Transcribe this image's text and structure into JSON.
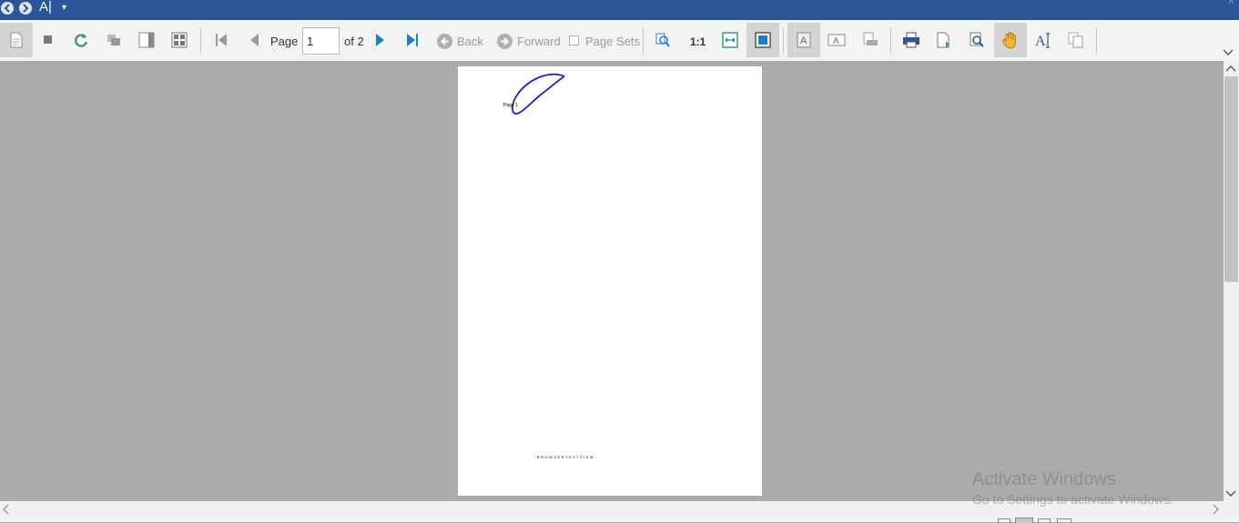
{
  "titlebar": {
    "title": "A|",
    "dropdown_glyph": "▾",
    "minimize_glyph": "^"
  },
  "toolbar": {
    "page_label": "Page",
    "page_value": "1",
    "page_of": "of 2",
    "back_label": "Back",
    "forward_label": "Forward",
    "page_sets_label": "Page Sets",
    "zoom_one_to_one": "1:1",
    "text_tool_glyph": "A",
    "accent_color": "#2b579a",
    "icon_blue": "#1c7fd1",
    "hand_color": "#f5a623"
  },
  "document": {
    "page_label": "Page 1",
    "footer_text": "- B R O W S E R  T E X T  V I E W -",
    "curve_color": "#1d1dcc"
  },
  "watermark": {
    "line1": "Activate Windows",
    "line2": "Go to Settings to activate Windows."
  },
  "icons": [
    "back-icon",
    "forward-icon",
    "document-icon",
    "stop-icon",
    "refresh-icon",
    "duplicate-icon",
    "sidebar-icon",
    "thumbnails-icon",
    "first-page-icon",
    "previous-page-icon",
    "next-page-icon",
    "last-page-icon",
    "zoom-icon",
    "fit-width-icon",
    "fit-page-icon",
    "text-select-icon",
    "text-frame-icon",
    "print-preview-icon",
    "printer-icon",
    "export-icon",
    "search-icon",
    "hand-icon",
    "text-cursor-icon",
    "copy-icon",
    "chevron-down-icon"
  ]
}
